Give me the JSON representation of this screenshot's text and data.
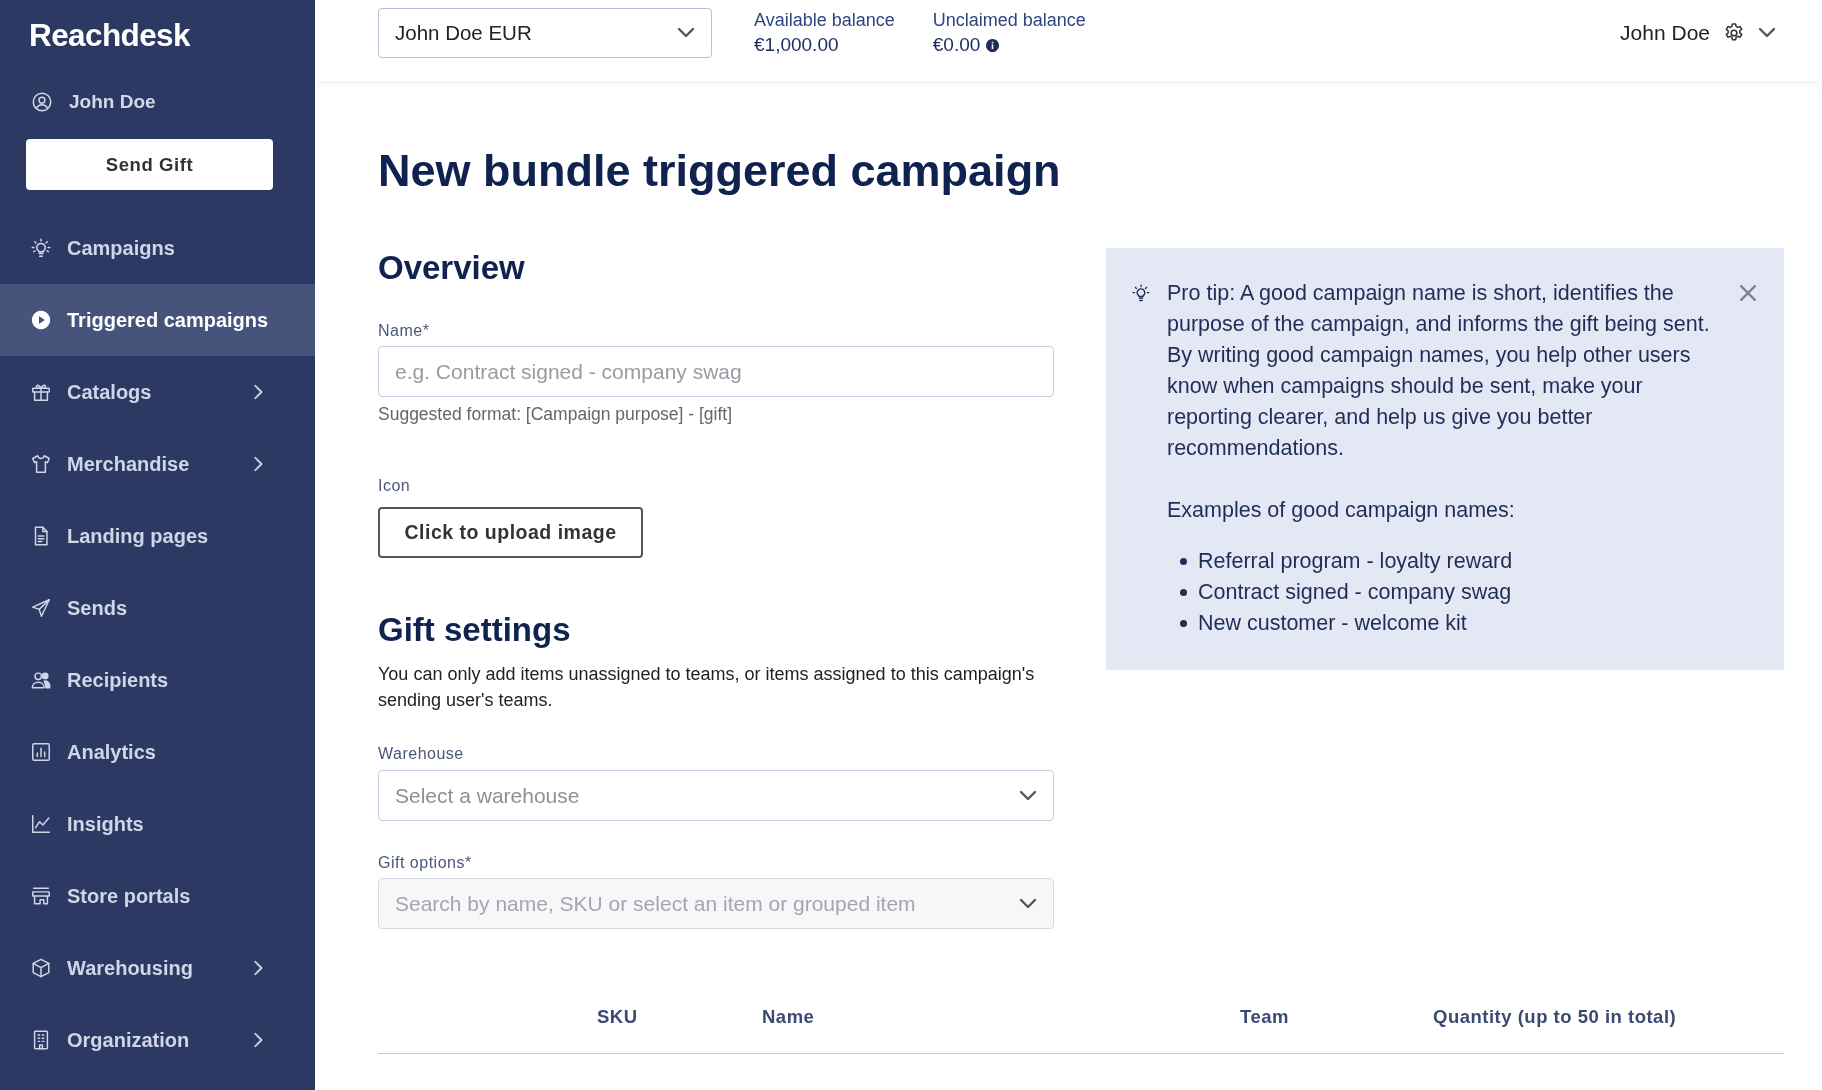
{
  "sidebar": {
    "logo": "Reachdesk",
    "user": "John Doe",
    "send_button": "Send Gift",
    "items": [
      {
        "label": "Campaigns",
        "selected": false,
        "expandable": false
      },
      {
        "label": "Triggered campaigns",
        "selected": true,
        "expandable": false
      },
      {
        "label": "Catalogs",
        "selected": false,
        "expandable": true
      },
      {
        "label": "Merchandise",
        "selected": false,
        "expandable": true
      },
      {
        "label": "Landing pages",
        "selected": false,
        "expandable": false
      },
      {
        "label": "Sends",
        "selected": false,
        "expandable": false
      },
      {
        "label": "Recipients",
        "selected": false,
        "expandable": false
      },
      {
        "label": "Analytics",
        "selected": false,
        "expandable": false
      },
      {
        "label": "Insights",
        "selected": false,
        "expandable": false
      },
      {
        "label": "Store portals",
        "selected": false,
        "expandable": false
      },
      {
        "label": "Warehousing",
        "selected": false,
        "expandable": true
      },
      {
        "label": "Organization",
        "selected": false,
        "expandable": true
      }
    ]
  },
  "top_bar": {
    "account_select": {
      "value": "John Doe EUR"
    },
    "balances": [
      {
        "label": "Available balance",
        "value": "€1,000.00",
        "info": false
      },
      {
        "label": "Unclaimed balance",
        "value": "€0.00",
        "info": true
      }
    ],
    "user_menu": {
      "name": "John Doe"
    }
  },
  "page": {
    "title": "New bundle triggered campaign",
    "overview": {
      "heading": "Overview",
      "name_field": {
        "label": "Name*",
        "placeholder": "e.g. Contract signed - company swag",
        "hint": "Suggested format: [Campaign purpose] - [gift]"
      },
      "icon_field": {
        "label": "Icon",
        "button": "Click to upload image"
      }
    },
    "pro_tip": {
      "text": "Pro tip: A good campaign name is short, identifies the purpose of the campaign, and informs the gift being sent. By writing good campaign names, you help other users know when campaigns should be sent, make your reporting clearer, and help us give you better recommendations.",
      "examples_heading": "Examples of good campaign names:",
      "examples": [
        "Referral program - loyalty reward",
        "Contract signed - company swag",
        "New customer - welcome kit"
      ]
    },
    "gift_settings": {
      "heading": "Gift settings",
      "description": "You can only add items unassigned to teams, or items assigned to this campaign's sending user's teams.",
      "warehouse": {
        "label": "Warehouse",
        "placeholder": "Select a warehouse",
        "disabled": false
      },
      "gift_options": {
        "label": "Gift options*",
        "placeholder": "Search by name, SKU or select an item or grouped item",
        "disabled": true
      }
    },
    "table": {
      "columns": [
        "SKU",
        "Name",
        "Team",
        "Quantity (up to 50 in total)"
      ]
    }
  }
}
